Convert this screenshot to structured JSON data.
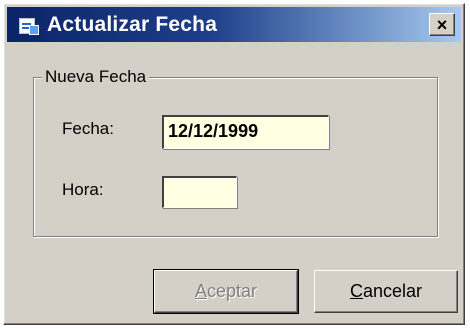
{
  "window": {
    "title": "Actualizar Fecha",
    "close_glyph": "×",
    "icon": "app-window-icon"
  },
  "group": {
    "legend": "Nueva Fecha"
  },
  "fields": {
    "fecha_label": "Fecha:",
    "fecha_value": "12/12/1999",
    "hora_label": "Hora:",
    "hora_value": ""
  },
  "buttons": {
    "aceptar_accel": "A",
    "aceptar_rest": "ceptar",
    "aceptar_enabled": false,
    "cancelar_accel": "C",
    "cancelar_rest": "ancelar"
  },
  "colors": {
    "titlebar_start": "#0a246a",
    "titlebar_end": "#a6caf0",
    "dialog_face": "#d4d0c8",
    "field_bg": "#ffffe1"
  }
}
